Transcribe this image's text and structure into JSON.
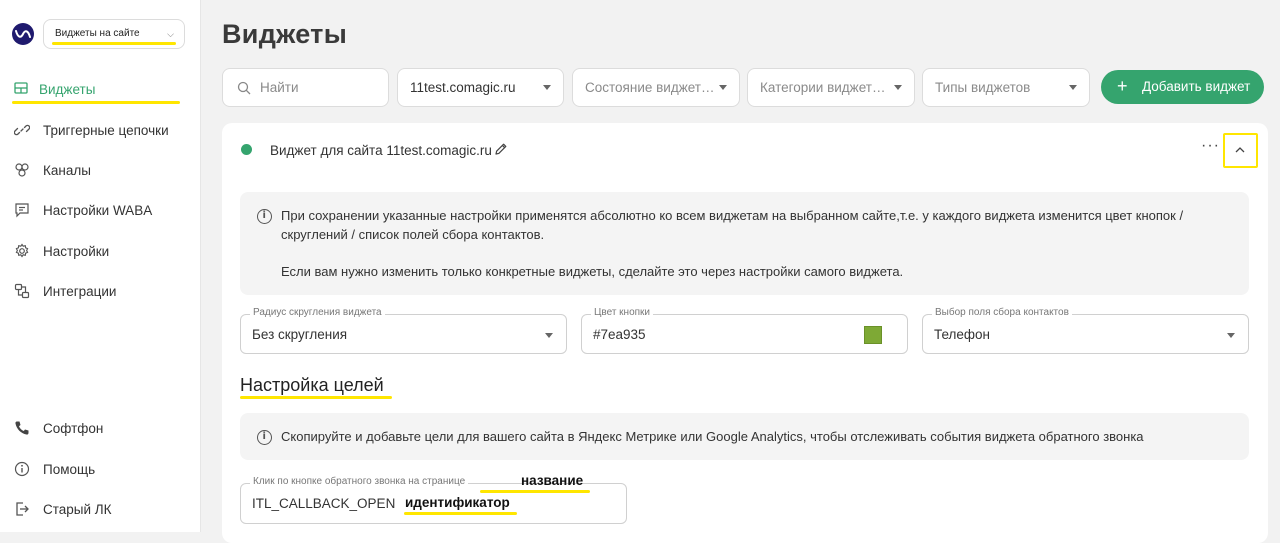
{
  "sidebar": {
    "site_select": "Виджеты на сайте",
    "items": [
      {
        "label": "Виджеты",
        "icon": "widgets-icon"
      },
      {
        "label": "Триггерные цепочки",
        "icon": "link-icon"
      },
      {
        "label": "Каналы",
        "icon": "channels-icon"
      },
      {
        "label": "Настройки WABA",
        "icon": "message-icon"
      },
      {
        "label": "Настройки",
        "icon": "gear-icon"
      },
      {
        "label": "Интеграции",
        "icon": "integrations-icon"
      }
    ],
    "bottom_items": [
      {
        "label": "Софтфон",
        "icon": "phone-icon"
      },
      {
        "label": "Помощь",
        "icon": "info-icon"
      },
      {
        "label": "Старый ЛК",
        "icon": "logout-icon"
      }
    ]
  },
  "page": {
    "title": "Виджеты"
  },
  "filters": {
    "search_placeholder": "Найти",
    "site": "11test.comagic.ru",
    "state": "Состояние виджет…",
    "category": "Категории виджет…",
    "type": "Типы виджетов"
  },
  "add_button": "Добавить виджет",
  "card": {
    "title": "Виджет для сайта 11test.comagic.ru",
    "info_line1": "При сохранении указанные настройки применятся абсолютно ко всем виджетам на выбранном сайте,т.е. у каждого виджета изменится цвет кнопок /",
    "info_line2": "скруглений / список полей сбора контактов.",
    "info_line3": "Если вам нужно изменить только конкретные виджеты, сделайте это через настройки самого виджета.",
    "fields": {
      "radius_label": "Радиус скругления виджета",
      "radius_value": "Без скругления",
      "color_label": "Цвет кнопки",
      "color_value": "#7ea935",
      "contact_label": "Выбор поля сбора контактов",
      "contact_value": "Телефон"
    },
    "goals_title": "Настройка целей",
    "goals_info": "Скопируйте и добавьте цели для вашего сайта в Яндекс Метрике или Google Analytics, чтобы отслеживать события виджета обратного звонка",
    "goal_field_label": "Клик по кнопке обратного звонка на странице",
    "goal_field_value": "ITL_CALLBACK_OPEN"
  },
  "annotations": {
    "name": "название",
    "identifier": "идентификатор"
  },
  "colors": {
    "accent": "#35a46e",
    "highlight": "#ffe600",
    "swatch": "#7ea935"
  }
}
